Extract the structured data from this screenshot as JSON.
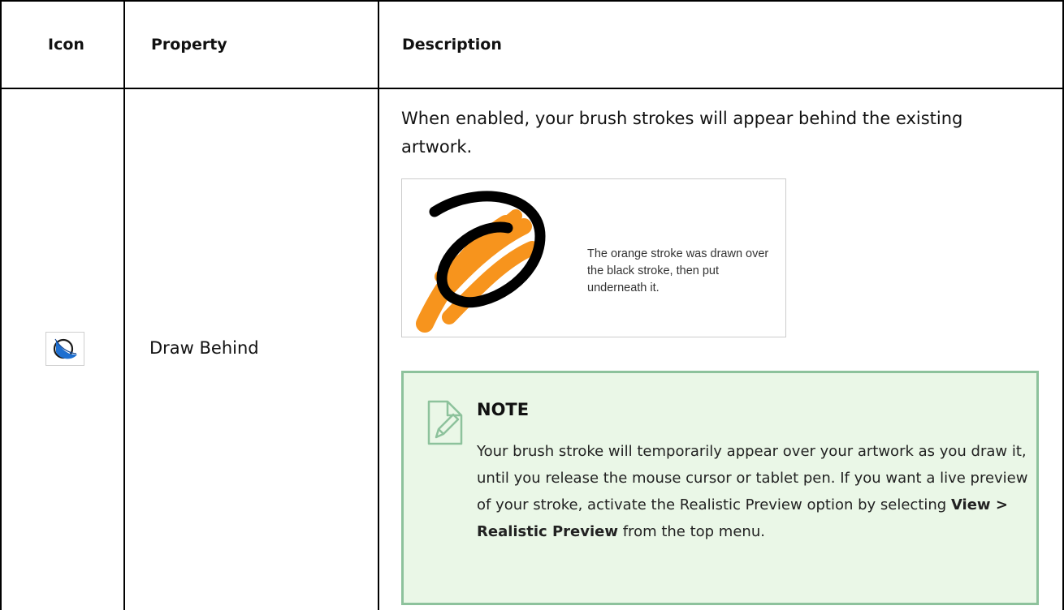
{
  "table": {
    "headers": {
      "icon": "Icon",
      "property": "Property",
      "description": "Description"
    },
    "row": {
      "icon_name": "draw-behind-icon",
      "property": "Draw Behind",
      "description": "When enabled, your brush strokes will appear behind the existing artwork.",
      "figure_caption": "The orange stroke was drawn over the black stroke, then put underneath it.",
      "note": {
        "title": "NOTE",
        "body_part1": "Your brush stroke will temporarily appear over your artwork as you draw it, until you release the mouse cursor or tablet pen.  If you want a live preview of your stroke, activate the Realistic Preview option by selecting ",
        "body_bold": "View > Realistic Preview",
        "body_part2": " from the top menu."
      }
    }
  },
  "colors": {
    "note_border": "#8dc29c",
    "note_background": "#eaf7e7",
    "orange_stroke": "#f7941d",
    "black_stroke": "#000000",
    "icon_blue": "#1e6fd0"
  }
}
